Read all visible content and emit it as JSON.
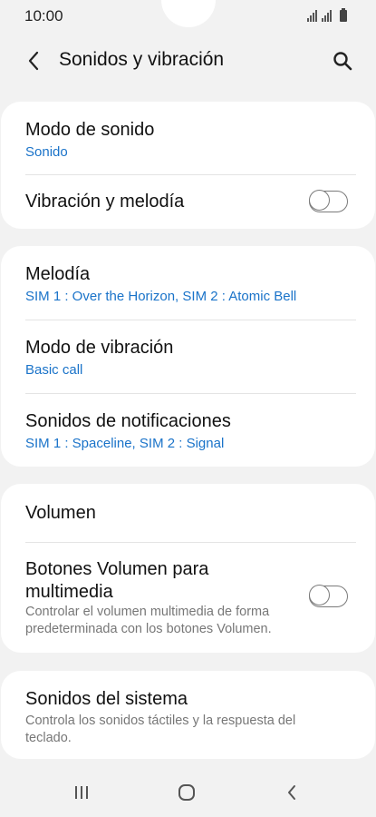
{
  "status_bar": {
    "time": "10:00",
    "icons": [
      "signal-sim1-icon",
      "signal-sim2-icon",
      "battery-icon"
    ]
  },
  "header": {
    "title": "Sonidos y vibración",
    "back_icon": "chevron-left-icon",
    "search_icon": "search-icon"
  },
  "cards": {
    "sound_mode": {
      "title": "Modo de sonido",
      "value": "Sonido"
    },
    "vibration_ringtone": {
      "title": "Vibración y melodía",
      "toggle_on": false
    },
    "ringtone": {
      "title": "Melodía",
      "value": "SIM 1 : Over the Horizon, SIM 2 : Atomic Bell"
    },
    "vibration_pattern": {
      "title": "Modo de vibración",
      "value": "Basic call"
    },
    "notification_sounds": {
      "title": "Sonidos de notificaciones",
      "value": "SIM 1 : Spaceline, SIM 2 : Signal"
    },
    "volume": {
      "title": "Volumen"
    },
    "volume_keys_media": {
      "title_line1": "Botones Volumen para",
      "title_line2": "multimedia",
      "desc_line1": "Controlar el volumen multimedia de forma",
      "desc_line2": "predeterminada con los botones Volumen.",
      "toggle_on": false
    },
    "system_sounds": {
      "title": "Sonidos del sistema",
      "desc_line1": "Controla los sonidos táctiles y la respuesta del",
      "desc_line2": "teclado."
    }
  },
  "nav_bar": {
    "icons": [
      "recent-apps-icon",
      "home-icon",
      "back-icon"
    ]
  },
  "colors": {
    "accent": "#1a73c9",
    "background": "#f2f2f2",
    "card": "#ffffff"
  }
}
